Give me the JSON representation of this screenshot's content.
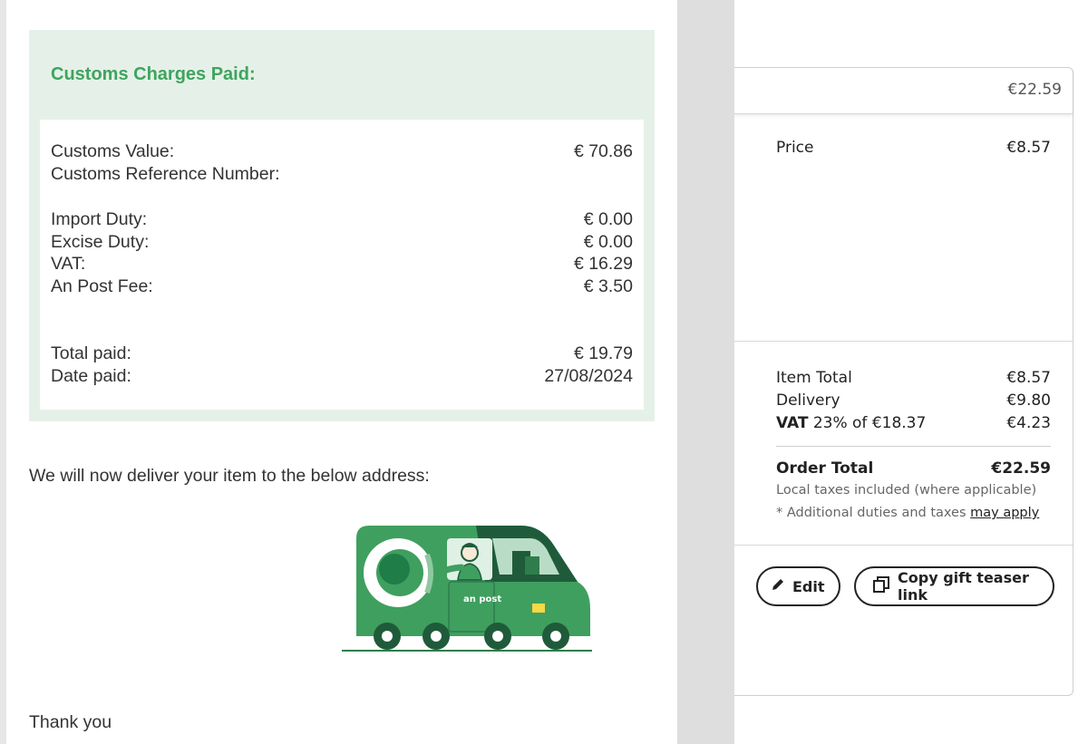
{
  "customs": {
    "title": "Customs Charges Paid:",
    "value_label": "Customs Value:",
    "value_amount": "€ 70.86",
    "reference_label": "Customs Reference Number:",
    "reference_value": "",
    "import_duty_label": "Import Duty:",
    "import_duty_amount": "€ 0.00",
    "excise_duty_label": "Excise Duty:",
    "excise_duty_amount": "€ 0.00",
    "vat_label": "VAT:",
    "vat_amount": "€ 16.29",
    "fee_label": "An Post Fee:",
    "fee_amount": "€ 3.50",
    "total_label": "Total paid:",
    "total_amount": "€ 19.79",
    "date_label": "Date paid:",
    "date_value": "27/08/2024"
  },
  "email": {
    "deliver_text": "We will now deliver your item to the below address:",
    "van_logo_text": "an post",
    "signoff": "Thank you"
  },
  "order": {
    "summary_amount": "€22.59",
    "price_label": "Price",
    "price_value": "€8.57",
    "item_total_label": "Item Total",
    "item_total_value": "€8.57",
    "delivery_label": "Delivery",
    "delivery_value": "€9.80",
    "vat_bold": "VAT",
    "vat_rest": " 23% of €18.37",
    "vat_value": "€4.23",
    "order_total_label": "Order Total",
    "order_total_value": "€22.59",
    "note_local": "Local taxes included (where applicable)",
    "note_additional_prefix": "* Additional duties and taxes ",
    "note_additional_link": "may apply",
    "edit_label": "Edit",
    "copy_label": "Copy gift teaser link"
  },
  "colors": {
    "brand_green": "#3fa45f",
    "dark_green": "#1f5b3a",
    "customs_bg": "#e5f1e8"
  },
  "icons": [
    "pencil-icon",
    "copy-icon"
  ]
}
